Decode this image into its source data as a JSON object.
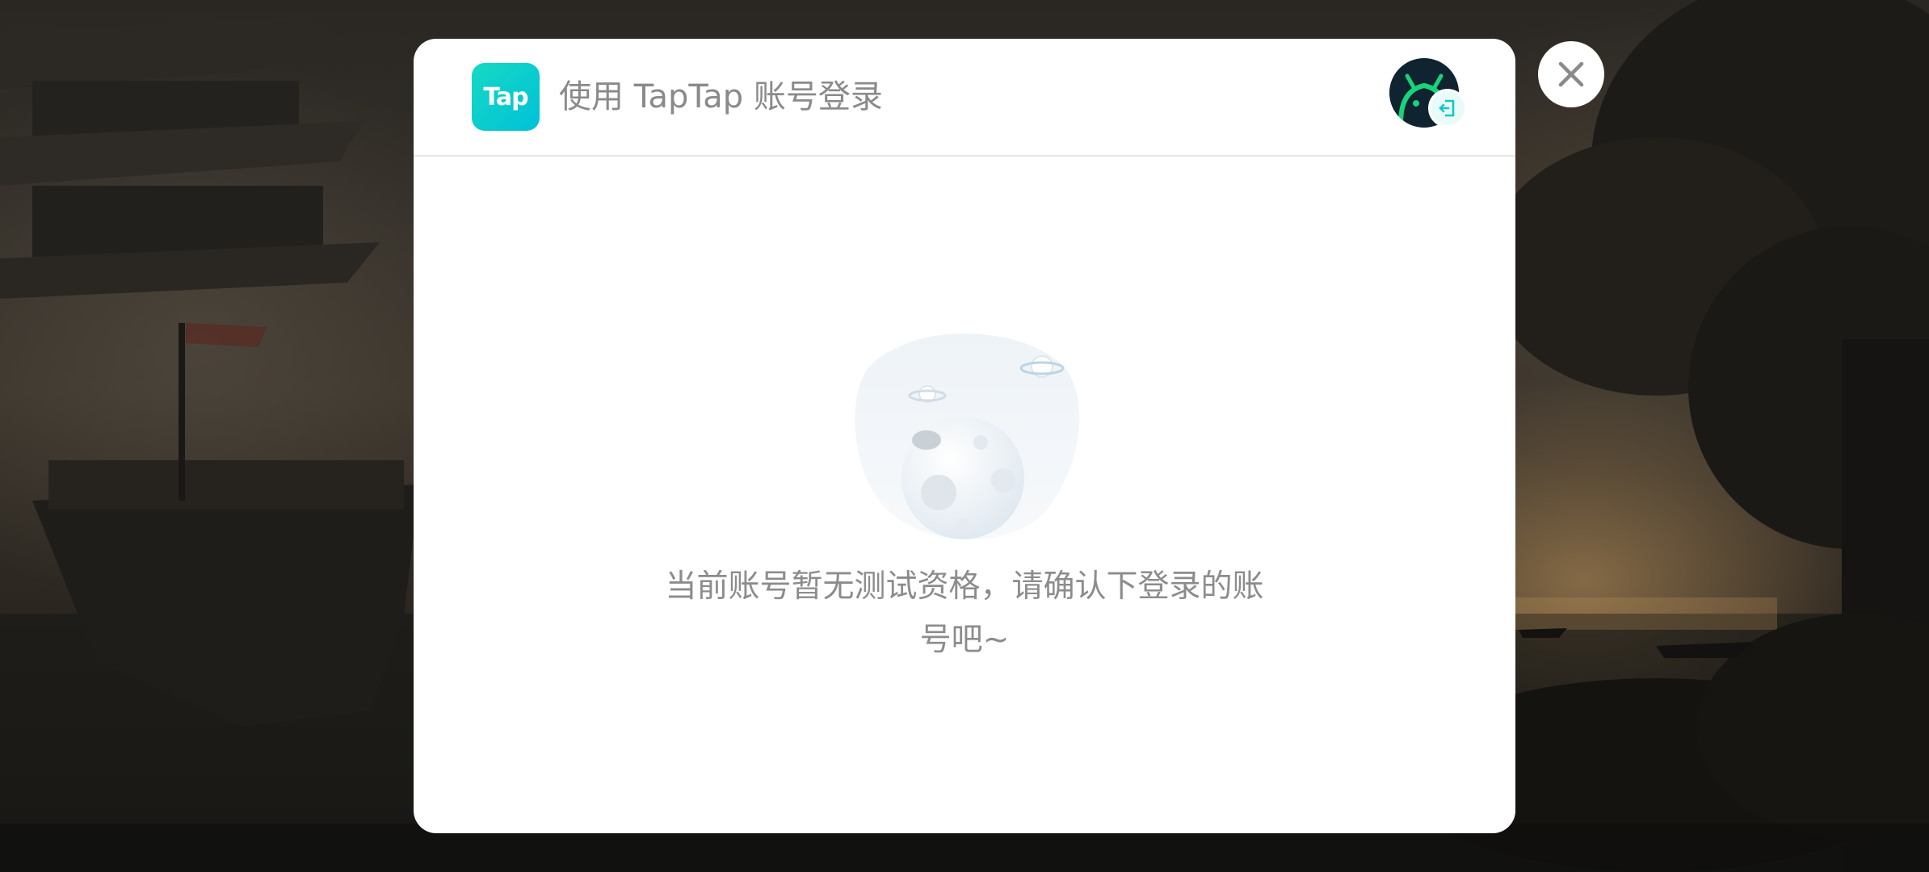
{
  "dialog": {
    "logo_text": "Tap",
    "title": "使用 TapTap 账号登录",
    "message": "当前账号暂无测试资格，请确认下登录的账号吧~"
  },
  "icons": {
    "logo": "taptap-logo",
    "avatar": "android-avatar",
    "logout": "logout-icon",
    "close": "close-icon",
    "illustration": "planet-moon-empty-state"
  },
  "colors": {
    "brand": "#00c9cf",
    "title_text": "#8a8a8a",
    "message_text": "#8c8c8c",
    "avatar_bg": "#0f2330",
    "avatar_accent": "#19d27a"
  }
}
